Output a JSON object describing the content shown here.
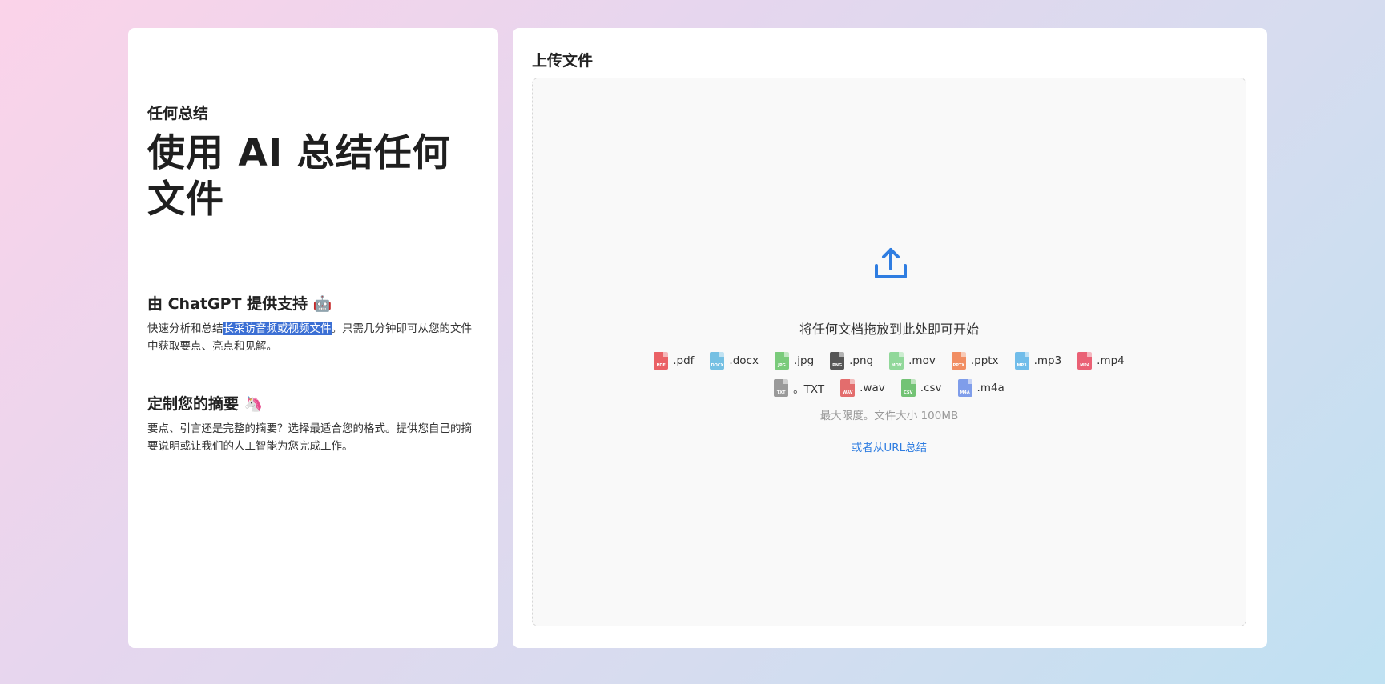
{
  "left": {
    "eyebrow": "任何总结",
    "hero_title": "使用 AI 总结任何文件",
    "features": [
      {
        "title": "由 ChatGPT 提供支持 🤖",
        "desc_before": "快速分析和总结",
        "desc_highlight": "长采访音频或视频文件",
        "desc_after": "。只需几分钟即可从您的文件中获取要点、亮点和见解。"
      },
      {
        "title": "定制您的摘要 🦄",
        "desc": "要点、引言还是完整的摘要？选择最适合您的格式。提供您自己的摘要说明或让我们的人工智能为您完成工作。"
      }
    ]
  },
  "upload": {
    "title": "上传文件",
    "icon": "upload-icon",
    "drop_text": "将任何文档拖放到此处即可开始",
    "file_types_row1": [
      {
        "ext": ".pdf",
        "tag": "PDF",
        "color": "#e8474c"
      },
      {
        "ext": ".docx",
        "tag": "DOCX",
        "color": "#5fb7e0"
      },
      {
        "ext": ".jpg",
        "tag": "JPG",
        "color": "#65c466"
      },
      {
        "ext": ".png",
        "tag": "PNG",
        "color": "#3a3a3a"
      },
      {
        "ext": ".mov",
        "tag": "MOV",
        "color": "#7fd38a"
      },
      {
        "ext": ".pptx",
        "tag": "PPTX",
        "color": "#f07c4a"
      },
      {
        "ext": ".mp3",
        "tag": "MP3",
        "color": "#5ab3e8"
      },
      {
        "ext": ".mp4",
        "tag": "MP4",
        "color": "#e8475f"
      }
    ],
    "file_types_row2": [
      {
        "ext": "。TXT",
        "tag": "TXT",
        "color": "#8a8a8a"
      },
      {
        "ext": ".wav",
        "tag": "WAV",
        "color": "#e05555"
      },
      {
        "ext": ".csv",
        "tag": "CSV",
        "color": "#5cba5e"
      },
      {
        "ext": ".m4a",
        "tag": "M4A",
        "color": "#6a8ee8"
      }
    ],
    "limit_text": "最大限度。文件大小 100MB",
    "url_link": "或者从URL总结"
  },
  "colors": {
    "accent": "#2f7de1",
    "highlight": "#3b6fd4"
  }
}
